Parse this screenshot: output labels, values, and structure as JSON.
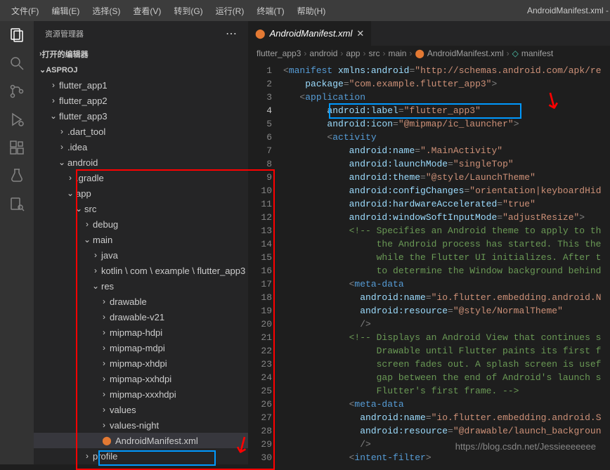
{
  "menubar": {
    "items": [
      "文件(F)",
      "编辑(E)",
      "选择(S)",
      "查看(V)",
      "转到(G)",
      "运行(R)",
      "终端(T)",
      "帮助(H)"
    ]
  },
  "window_title": "AndroidManifest.xml - ASProj - Visual S",
  "sidebar": {
    "title": "资源管理器",
    "open_editors": "打开的编辑器",
    "project": "ASPROJ",
    "tree": [
      {
        "label": "flutter_app1",
        "indent": 1,
        "chev": "›"
      },
      {
        "label": "flutter_app2",
        "indent": 1,
        "chev": "›"
      },
      {
        "label": "flutter_app3",
        "indent": 1,
        "chev": "⌄"
      },
      {
        "label": ".dart_tool",
        "indent": 2,
        "chev": "›"
      },
      {
        "label": ".idea",
        "indent": 2,
        "chev": "›"
      },
      {
        "label": "android",
        "indent": 2,
        "chev": "⌄"
      },
      {
        "label": ".gradle",
        "indent": 3,
        "chev": "›"
      },
      {
        "label": "app",
        "indent": 3,
        "chev": "⌄"
      },
      {
        "label": "src",
        "indent": 4,
        "chev": "⌄"
      },
      {
        "label": "debug",
        "indent": 5,
        "chev": "›"
      },
      {
        "label": "main",
        "indent": 5,
        "chev": "⌄"
      },
      {
        "label": "java",
        "indent": 6,
        "chev": "›"
      },
      {
        "label": "kotlin \\ com \\ example \\ flutter_app3",
        "indent": 6,
        "chev": "›"
      },
      {
        "label": "res",
        "indent": 6,
        "chev": "⌄"
      },
      {
        "label": "drawable",
        "indent": 7,
        "chev": "›"
      },
      {
        "label": "drawable-v21",
        "indent": 7,
        "chev": "›"
      },
      {
        "label": "mipmap-hdpi",
        "indent": 7,
        "chev": "›"
      },
      {
        "label": "mipmap-mdpi",
        "indent": 7,
        "chev": "›"
      },
      {
        "label": "mipmap-xhdpi",
        "indent": 7,
        "chev": "›"
      },
      {
        "label": "mipmap-xxhdpi",
        "indent": 7,
        "chev": "›"
      },
      {
        "label": "mipmap-xxxhdpi",
        "indent": 7,
        "chev": "›"
      },
      {
        "label": "values",
        "indent": 7,
        "chev": "›"
      },
      {
        "label": "values-night",
        "indent": 7,
        "chev": "›"
      },
      {
        "label": "AndroidManifest.xml",
        "indent": 6,
        "chev": "",
        "icon": "xml",
        "selected": true
      },
      {
        "label": "profile",
        "indent": 5,
        "chev": "›"
      }
    ]
  },
  "tab": {
    "filename": "AndroidManifest.xml"
  },
  "breadcrumb": {
    "parts": [
      "flutter_app3",
      "android",
      "app",
      "src",
      "main",
      "AndroidManifest.xml",
      "manifest"
    ]
  },
  "code": {
    "lines": [
      {
        "n": 1,
        "parts": [
          {
            "t": "<",
            "c": "punct"
          },
          {
            "t": "manifest",
            "c": "tag"
          },
          {
            "t": " ",
            "c": ""
          },
          {
            "t": "xmlns:android",
            "c": "attr"
          },
          {
            "t": "=",
            "c": "punct"
          },
          {
            "t": "\"http://schemas.android.com/apk/re",
            "c": "str"
          }
        ]
      },
      {
        "n": 2,
        "parts": [
          {
            "t": "    ",
            "c": ""
          },
          {
            "t": "package",
            "c": "attr"
          },
          {
            "t": "=",
            "c": "punct"
          },
          {
            "t": "\"com.example.flutter_app3\"",
            "c": "str"
          },
          {
            "t": ">",
            "c": "punct"
          }
        ]
      },
      {
        "n": 3,
        "parts": [
          {
            "t": "   <",
            "c": "punct"
          },
          {
            "t": "application",
            "c": "tag"
          }
        ]
      },
      {
        "n": 4,
        "active": true,
        "parts": [
          {
            "t": "        ",
            "c": ""
          },
          {
            "t": "android:label",
            "c": "attr"
          },
          {
            "t": "=",
            "c": "punct"
          },
          {
            "t": "\"flutter_app3\"",
            "c": "str"
          }
        ]
      },
      {
        "n": 5,
        "parts": [
          {
            "t": "        ",
            "c": ""
          },
          {
            "t": "android:icon",
            "c": "attr"
          },
          {
            "t": "=",
            "c": "punct"
          },
          {
            "t": "\"@mipmap/ic_launcher\"",
            "c": "str"
          },
          {
            "t": ">",
            "c": "punct"
          }
        ]
      },
      {
        "n": 6,
        "parts": [
          {
            "t": "        <",
            "c": "punct"
          },
          {
            "t": "activity",
            "c": "tag"
          }
        ]
      },
      {
        "n": 7,
        "parts": [
          {
            "t": "            ",
            "c": ""
          },
          {
            "t": "android:name",
            "c": "attr"
          },
          {
            "t": "=",
            "c": "punct"
          },
          {
            "t": "\".MainActivity\"",
            "c": "str"
          }
        ]
      },
      {
        "n": 8,
        "parts": [
          {
            "t": "            ",
            "c": ""
          },
          {
            "t": "android:launchMode",
            "c": "attr"
          },
          {
            "t": "=",
            "c": "punct"
          },
          {
            "t": "\"singleTop\"",
            "c": "str"
          }
        ]
      },
      {
        "n": 9,
        "parts": [
          {
            "t": "            ",
            "c": ""
          },
          {
            "t": "android:theme",
            "c": "attr"
          },
          {
            "t": "=",
            "c": "punct"
          },
          {
            "t": "\"@style/LaunchTheme\"",
            "c": "str"
          }
        ]
      },
      {
        "n": 10,
        "parts": [
          {
            "t": "            ",
            "c": ""
          },
          {
            "t": "android:configChanges",
            "c": "attr"
          },
          {
            "t": "=",
            "c": "punct"
          },
          {
            "t": "\"orientation|keyboardHid",
            "c": "str"
          }
        ]
      },
      {
        "n": 11,
        "parts": [
          {
            "t": "            ",
            "c": ""
          },
          {
            "t": "android:hardwareAccelerated",
            "c": "attr"
          },
          {
            "t": "=",
            "c": "punct"
          },
          {
            "t": "\"true\"",
            "c": "str"
          }
        ]
      },
      {
        "n": 12,
        "parts": [
          {
            "t": "            ",
            "c": ""
          },
          {
            "t": "android:windowSoftInputMode",
            "c": "attr"
          },
          {
            "t": "=",
            "c": "punct"
          },
          {
            "t": "\"adjustResize\"",
            "c": "str"
          },
          {
            "t": ">",
            "c": "punct"
          }
        ]
      },
      {
        "n": 13,
        "parts": [
          {
            "t": "            <!-- Specifies an Android theme to apply to th",
            "c": "comment"
          }
        ]
      },
      {
        "n": 14,
        "parts": [
          {
            "t": "                 the Android process has started. This the",
            "c": "comment"
          }
        ]
      },
      {
        "n": 15,
        "parts": [
          {
            "t": "                 while the Flutter UI initializes. After t",
            "c": "comment"
          }
        ]
      },
      {
        "n": 16,
        "parts": [
          {
            "t": "                 to determine the Window background behind",
            "c": "comment"
          }
        ]
      },
      {
        "n": 17,
        "parts": [
          {
            "t": "            <",
            "c": "punct"
          },
          {
            "t": "meta-data",
            "c": "tag"
          }
        ]
      },
      {
        "n": 18,
        "parts": [
          {
            "t": "              ",
            "c": ""
          },
          {
            "t": "android:name",
            "c": "attr"
          },
          {
            "t": "=",
            "c": "punct"
          },
          {
            "t": "\"io.flutter.embedding.android.N",
            "c": "str"
          }
        ]
      },
      {
        "n": 19,
        "parts": [
          {
            "t": "              ",
            "c": ""
          },
          {
            "t": "android:resource",
            "c": "attr"
          },
          {
            "t": "=",
            "c": "punct"
          },
          {
            "t": "\"@style/NormalTheme\"",
            "c": "str"
          }
        ]
      },
      {
        "n": 20,
        "parts": [
          {
            "t": "              />",
            "c": "punct"
          }
        ]
      },
      {
        "n": 21,
        "parts": [
          {
            "t": "            <!-- Displays an Android View that continues s",
            "c": "comment"
          }
        ]
      },
      {
        "n": 22,
        "parts": [
          {
            "t": "                 Drawable until Flutter paints its first f",
            "c": "comment"
          }
        ]
      },
      {
        "n": 23,
        "parts": [
          {
            "t": "                 screen fades out. A splash screen is usef",
            "c": "comment"
          }
        ]
      },
      {
        "n": 24,
        "parts": [
          {
            "t": "                 gap between the end of Android's launch s",
            "c": "comment"
          }
        ]
      },
      {
        "n": 25,
        "parts": [
          {
            "t": "                 Flutter's first frame. -->",
            "c": "comment"
          }
        ]
      },
      {
        "n": 26,
        "parts": [
          {
            "t": "            <",
            "c": "punct"
          },
          {
            "t": "meta-data",
            "c": "tag"
          }
        ]
      },
      {
        "n": 27,
        "parts": [
          {
            "t": "              ",
            "c": ""
          },
          {
            "t": "android:name",
            "c": "attr"
          },
          {
            "t": "=",
            "c": "punct"
          },
          {
            "t": "\"io.flutter.embedding.android.S",
            "c": "str"
          }
        ]
      },
      {
        "n": 28,
        "parts": [
          {
            "t": "              ",
            "c": ""
          },
          {
            "t": "android:resource",
            "c": "attr"
          },
          {
            "t": "=",
            "c": "punct"
          },
          {
            "t": "\"@drawable/launch_backgroun",
            "c": "str"
          }
        ]
      },
      {
        "n": 29,
        "parts": [
          {
            "t": "              />",
            "c": "punct"
          }
        ]
      },
      {
        "n": 30,
        "parts": [
          {
            "t": "            <",
            "c": "punct"
          },
          {
            "t": "intent-filter",
            "c": "tag"
          },
          {
            "t": ">",
            "c": "punct"
          }
        ]
      }
    ]
  },
  "watermark": "https://blog.csdn.net/Jessieeeeeee"
}
